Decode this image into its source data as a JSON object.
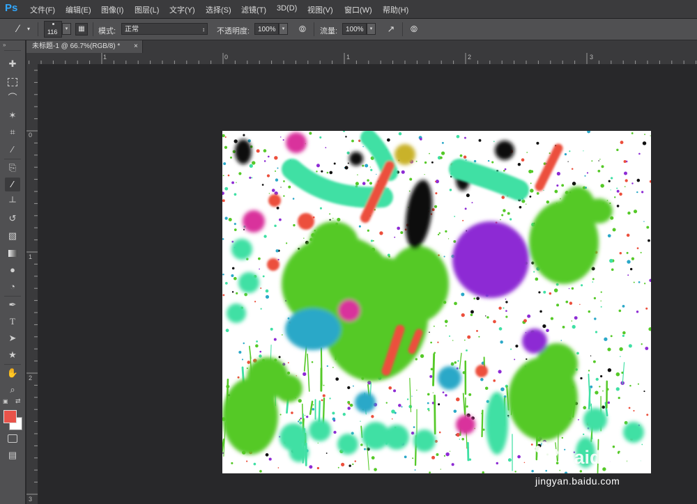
{
  "app": {
    "logo": "Ps"
  },
  "menu": [
    {
      "label": "文件(F)"
    },
    {
      "label": "编辑(E)"
    },
    {
      "label": "图像(I)"
    },
    {
      "label": "图层(L)"
    },
    {
      "label": "文字(Y)"
    },
    {
      "label": "选择(S)"
    },
    {
      "label": "滤镜(T)"
    },
    {
      "label": "3D(D)"
    },
    {
      "label": "视图(V)"
    },
    {
      "label": "窗口(W)"
    },
    {
      "label": "帮助(H)"
    }
  ],
  "options": {
    "brush_size": "116",
    "mode_label": "模式:",
    "mode_value": "正常",
    "opacity_label": "不透明度:",
    "opacity_value": "100%",
    "flow_label": "流量:",
    "flow_value": "100%"
  },
  "document": {
    "tab_title": "未标题-1 @ 66.7%(RGB/8) *",
    "close_glyph": "×"
  },
  "ruler": {
    "top": [
      "1",
      "0",
      "1",
      "2",
      "3"
    ],
    "left": [
      "0",
      "1",
      "2",
      "3"
    ]
  },
  "colors": {
    "foreground": "#e8534a",
    "background": "#ffffff",
    "paint_green": "#55c928",
    "paint_mint": "#3fe0a4",
    "paint_purple": "#8d2bd4",
    "paint_magenta": "#d9309c",
    "paint_red": "#ec4f3c",
    "paint_black": "#111111",
    "paint_yellow": "#c9b22a",
    "paint_cyan": "#2aa8c8"
  },
  "watermark": {
    "logo_text": "Baidu",
    "logo_cn": "经验",
    "url": "jingyan.baidu.com"
  }
}
